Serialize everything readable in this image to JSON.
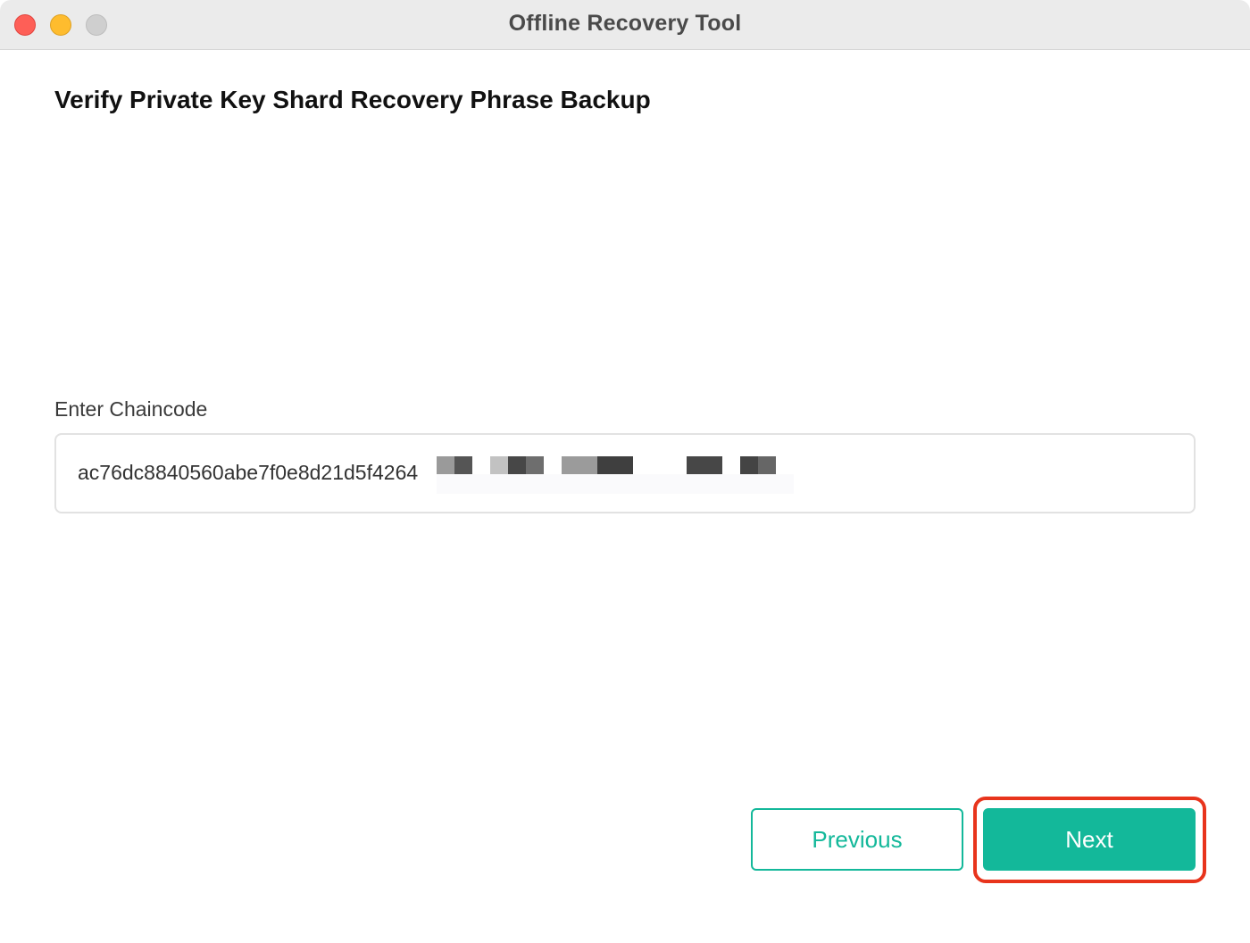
{
  "window": {
    "title": "Offline Recovery Tool",
    "controls": [
      "close",
      "minimize",
      "zoom"
    ]
  },
  "page": {
    "title": "Verify Private Key Shard Recovery Phrase Backup"
  },
  "chaincode": {
    "label": "Enter Chaincode",
    "value": "ac76dc8840560abe7f0e8d21d5f4264",
    "redacted": true
  },
  "actions": {
    "previous_label": "Previous",
    "next_label": "Next",
    "highlighted": "next"
  },
  "colors": {
    "accent": "#13b89a",
    "highlight": "#e8341c",
    "titlebar": "#ebebeb"
  }
}
